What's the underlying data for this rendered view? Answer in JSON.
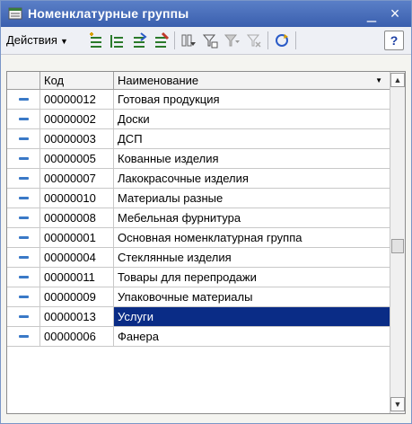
{
  "window": {
    "title": "Номенклатурные группы",
    "minimize_label": "_",
    "close_label": "×"
  },
  "toolbar": {
    "actions_label": "Действия",
    "actions_arrow": "▼",
    "help_label": "?",
    "icons": [
      "add-icon",
      "add-group-icon",
      "copy-icon",
      "edit-icon",
      "filter-icon",
      "filter-set-icon",
      "filter-list-icon",
      "filter-clear-icon",
      "refresh-icon",
      "help-icon"
    ]
  },
  "grid": {
    "columns": [
      "Код",
      "Наименование"
    ],
    "sort_marker": "▼",
    "rows": [
      {
        "code": "00000012",
        "name": "Готовая продукция"
      },
      {
        "code": "00000002",
        "name": "Доски"
      },
      {
        "code": "00000003",
        "name": "ДСП"
      },
      {
        "code": "00000005",
        "name": "Кованные изделия"
      },
      {
        "code": "00000007",
        "name": "Лакокрасочные изделия"
      },
      {
        "code": "00000010",
        "name": "Материалы разные"
      },
      {
        "code": "00000008",
        "name": "Мебельная фурнитура"
      },
      {
        "code": "00000001",
        "name": "Основная номенклатурная группа"
      },
      {
        "code": "00000004",
        "name": "Стеклянные изделия"
      },
      {
        "code": "00000011",
        "name": "Товары для перепродажи"
      },
      {
        "code": "00000009",
        "name": "Упаковочные материалы"
      },
      {
        "code": "00000013",
        "name": "Услуги"
      },
      {
        "code": "00000006",
        "name": "Фанера"
      }
    ],
    "selected_row": 11,
    "scroll_up": "▲",
    "scroll_down": "▼"
  },
  "colors": {
    "title_bar": "#3a5fae",
    "selection": "#0a2c86",
    "row_marker": "#3a79c7"
  }
}
